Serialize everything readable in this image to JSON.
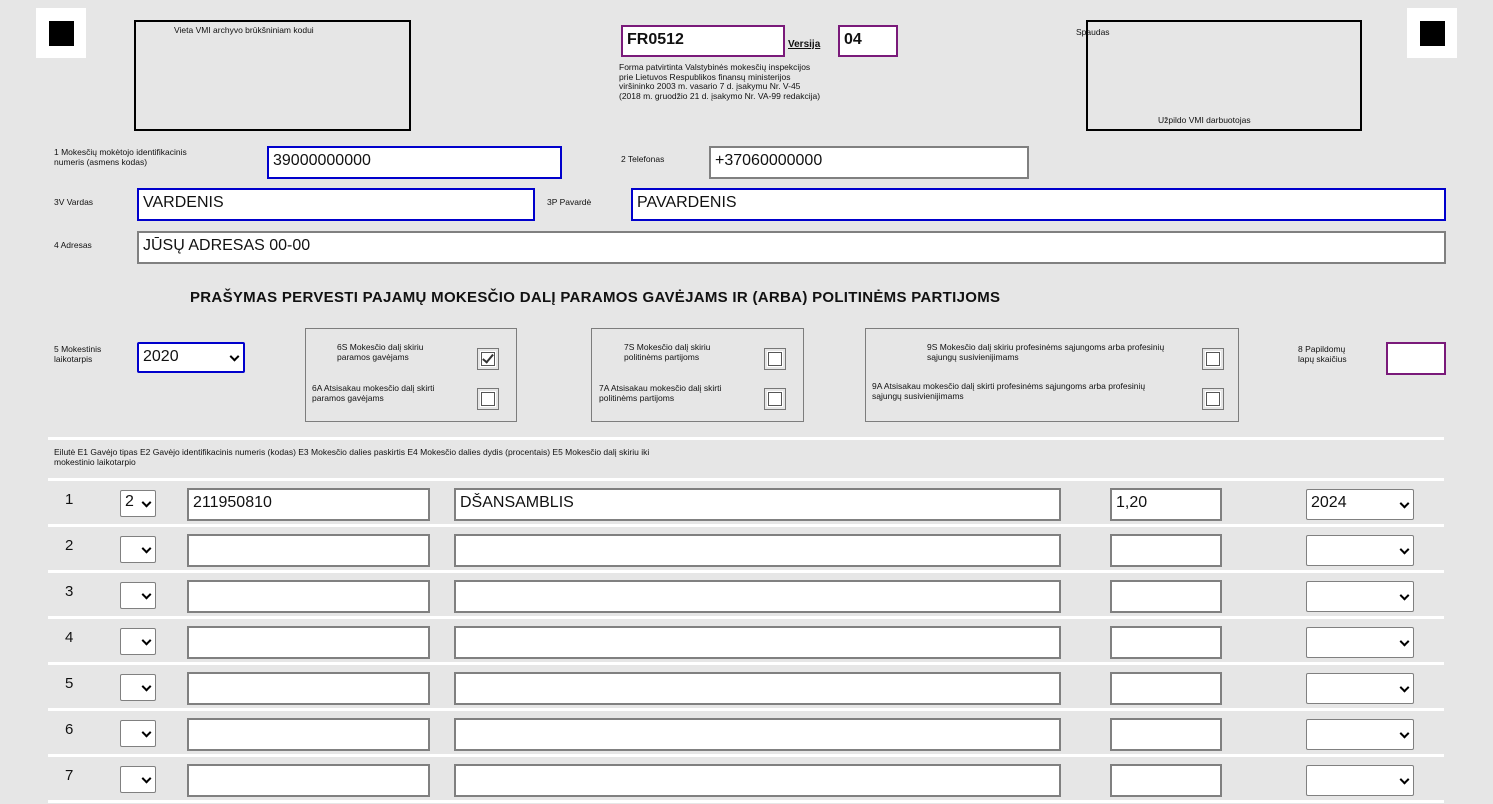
{
  "header": {
    "archive_label": "Vieta VMI archyvo brūkšniniam kodui",
    "form_code": "FR0512",
    "version_label": "Versija",
    "version_value": "04",
    "approval_line1": "Forma patvirtinta Valstybinės mokesčių inspekcijos",
    "approval_line2": "prie Lietuvos Respublikos finansų ministerijos",
    "approval_line3": "viršininko 2003 m. vasario 7 d. įsakymu Nr. V-45",
    "approval_line4": "(2018 m. gruodžio 21 d. įsakymo Nr. VA-99 redakcija)",
    "stamp_label": "Spaudas",
    "stamp_footer": "Užpildo VMI darbuotojas"
  },
  "fields": {
    "taxpayer_id_label_1": "1 Mokesčių mokėtojo identifikacinis",
    "taxpayer_id_label_2": "numeris (asmens kodas)",
    "taxpayer_id_value": "39000000000",
    "phone_label": "2 Telefonas",
    "phone_value": "+37060000000",
    "first_name_label": "3V Vardas",
    "first_name_value": "VARDENIS",
    "last_name_label": "3P Pavardė",
    "last_name_value": "PAVARDENIS",
    "address_label": "4 Adresas",
    "address_value": "JŪSŲ ADRESAS 00-00"
  },
  "form_title": "PRAŠYMAS PERVESTI PAJAMŲ MOKESČIO DALĮ PARAMOS GAVĖJAMS IR (ARBA) POLITINĖMS PARTIJOMS",
  "period": {
    "label_1": "5 Mokestinis",
    "label_2": "laikotarpis",
    "value": "2020"
  },
  "options": {
    "support_give_1": "6S Mokesčio dalį skiriu",
    "support_give_2": "paramos gavėjams",
    "support_give_checked": true,
    "support_refuse_1": "6A Atsisakau mokesčio dalį skirti",
    "support_refuse_2": "paramos gavėjams",
    "party_give_1": "7S Mokesčio dalį skiriu",
    "party_give_2": "politinėms partijoms",
    "party_refuse_1": "7A Atsisakau mokesčio dalį skirti",
    "party_refuse_2": "politinėms partijoms",
    "union_give_1": "9S Mokesčio dalį skiriu profesinėms sąjungoms arba profesinių",
    "union_give_2": "sąjungų susivienijimams",
    "union_refuse_1": "9A Atsisakau mokesčio dalį skirti profesinėms sąjungoms arba profesinių",
    "union_refuse_2": "sąjungų susivienijimams"
  },
  "extra_pages": {
    "label_1": "8 Papildomų",
    "label_2": "lapų skaičius",
    "value": ""
  },
  "table": {
    "header_1": "Eilutė E1 Gavėjo tipas E2 Gavėjo identifikacinis numeris (kodas) E3 Mokesčio dalies paskirtis E4 Mokesčio dalies dydis (procentais) E5 Mokesčio dalį skiriu iki",
    "header_2": "mokestinio laikotarpio",
    "rows": [
      {
        "num": "1",
        "type": "2",
        "id": "211950810",
        "purpose": "DŠANSAMBLIS",
        "percent": "1,20",
        "until": "2024"
      },
      {
        "num": "2",
        "type": "",
        "id": "",
        "purpose": "",
        "percent": "",
        "until": ""
      },
      {
        "num": "3",
        "type": "",
        "id": "",
        "purpose": "",
        "percent": "",
        "until": ""
      },
      {
        "num": "4",
        "type": "",
        "id": "",
        "purpose": "",
        "percent": "",
        "until": ""
      },
      {
        "num": "5",
        "type": "",
        "id": "",
        "purpose": "",
        "percent": "",
        "until": ""
      },
      {
        "num": "6",
        "type": "",
        "id": "",
        "purpose": "",
        "percent": "",
        "until": ""
      },
      {
        "num": "7",
        "type": "",
        "id": "",
        "purpose": "",
        "percent": "",
        "until": ""
      }
    ]
  }
}
